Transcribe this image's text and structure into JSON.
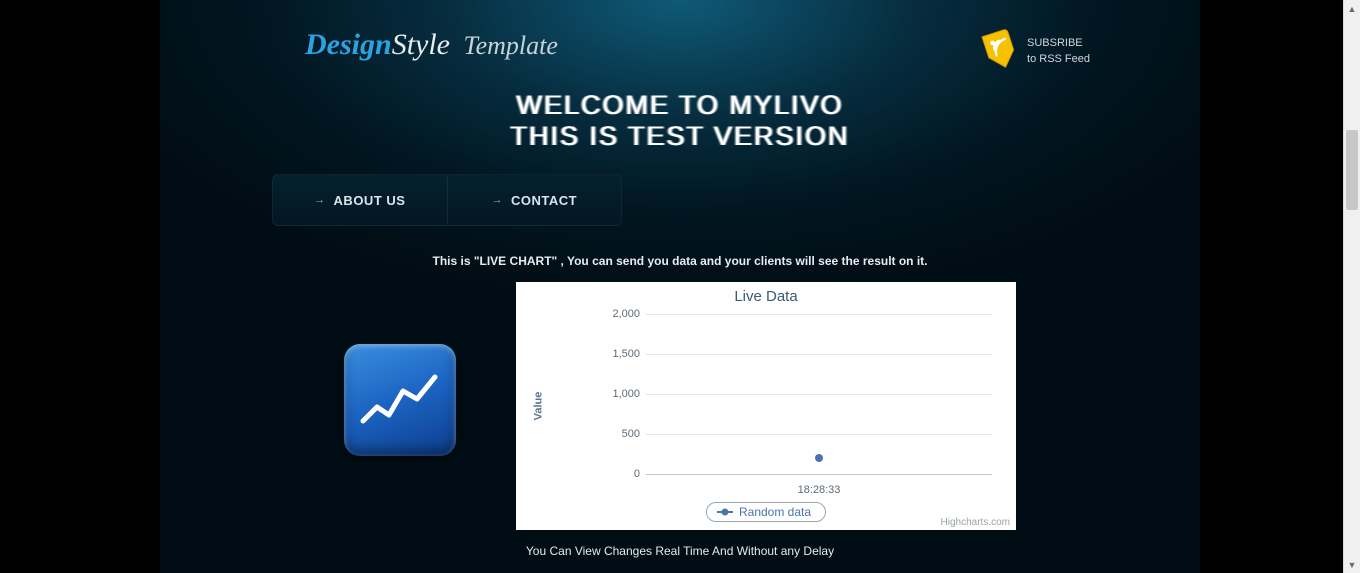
{
  "logo": {
    "part1": "Design",
    "part2": "Style",
    "part3": "Template"
  },
  "rss": {
    "line1": "SUBSRIBE",
    "line2": "to RSS Feed"
  },
  "hero": {
    "line1": "WELCOME TO MYLIVO",
    "line2": "THIS IS TEST VERSION"
  },
  "nav": {
    "about": "ABOUT US",
    "contact": "CONTACT"
  },
  "intro_text": "This is \"LIVE CHART\" , You can send you data and your clients will see the result on it.",
  "outro_text": "You Can View Changes Real Time And Without any Delay",
  "chart_ui": {
    "title": "Live Data",
    "ylabel": "Value",
    "legend": "Random data",
    "credits": "Highcharts.com",
    "xtick": "18:28:33"
  },
  "chart_data": {
    "type": "line",
    "title": "Live Data",
    "xlabel": "",
    "ylabel": "Value",
    "ylim": [
      0,
      2000
    ],
    "yticks": [
      0,
      500,
      1000,
      1500,
      2000
    ],
    "series": [
      {
        "name": "Random data",
        "x": [
          "18:28:33"
        ],
        "values": [
          200
        ]
      }
    ],
    "legend_position": "bottom",
    "grid": true
  }
}
